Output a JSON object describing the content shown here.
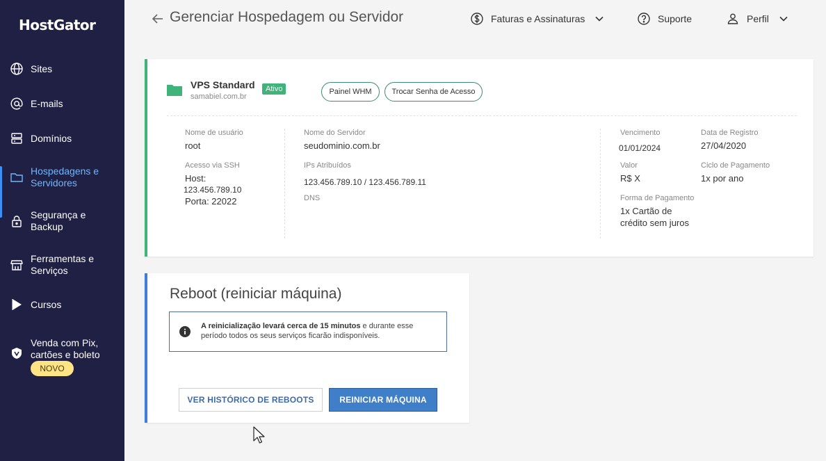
{
  "brand": {
    "logo": "HostGator"
  },
  "sidebar": {
    "items": [
      {
        "label": "Sites",
        "icon": "globe-icon"
      },
      {
        "label": "E-mails",
        "icon": "at-icon"
      },
      {
        "label": "Domínios",
        "icon": "server-icon"
      },
      {
        "label": "Hospedagens e Servidores",
        "icon": "folder-icon",
        "active": true
      },
      {
        "label": "Segurança e Backup",
        "icon": "lock-icon"
      },
      {
        "label": "Ferramentas e Serviços",
        "icon": "store-icon"
      },
      {
        "label": "Cursos",
        "icon": "play-icon"
      },
      {
        "label": "Venda com Pix, cartões e boleto",
        "icon": "shield-icon"
      }
    ],
    "novo_badge": "NOVO"
  },
  "header": {
    "title": "Gerenciar Hospedagem ou Servidor",
    "billing": "Faturas e Assinaturas",
    "support": "Suporte",
    "profile": "Perfil"
  },
  "plan": {
    "name": "VPS Standard",
    "domain": "samabiel.com.br",
    "status": "Ativo",
    "btn_whm": "Painel WHM",
    "btn_password": "Trocar Senha de Acesso",
    "username_label": "Nome de usuário",
    "username": "root",
    "ssh_label": "Acesso via SSH",
    "ssh_host": "Host:",
    "ssh_ip": "123.456.789.10",
    "ssh_port": "Porta: 22022",
    "server_name_label": "Nome do Servidor",
    "server_name": "seudominio.com.br",
    "ips_label": "IPs Atribuídos",
    "ips": "123.456.789.10 / 123.456.789.11",
    "dns_label": "DNS",
    "due_label": "Vencimento",
    "due": "01/01/2024",
    "reg_label": "Data de Registro",
    "reg": "27/04/2020",
    "value_label": "Valor",
    "value": "R$ X",
    "cycle_label": "Ciclo de Pagamento",
    "cycle": "1x por ano",
    "payment_label": "Forma de Pagamento",
    "payment_line1": "1x Cartão de",
    "payment_line2": "crédito sem juros"
  },
  "reboot": {
    "title": "Reboot (reiniciar máquina)",
    "info_bold": "A reinicialização levará cerca de 15 minutos",
    "info_rest": " e durante esse período todos os seus serviços ficarão indisponíveis.",
    "btn_history": "VER HISTÓRICO DE REBOOTS",
    "btn_restart": "REINICIAR MÁQUINA"
  },
  "colors": {
    "sidebar_bg": "#1f2044",
    "active_text": "#6fb7ff",
    "status_green": "#3fb37a",
    "primary_blue": "#3f7ec8"
  }
}
